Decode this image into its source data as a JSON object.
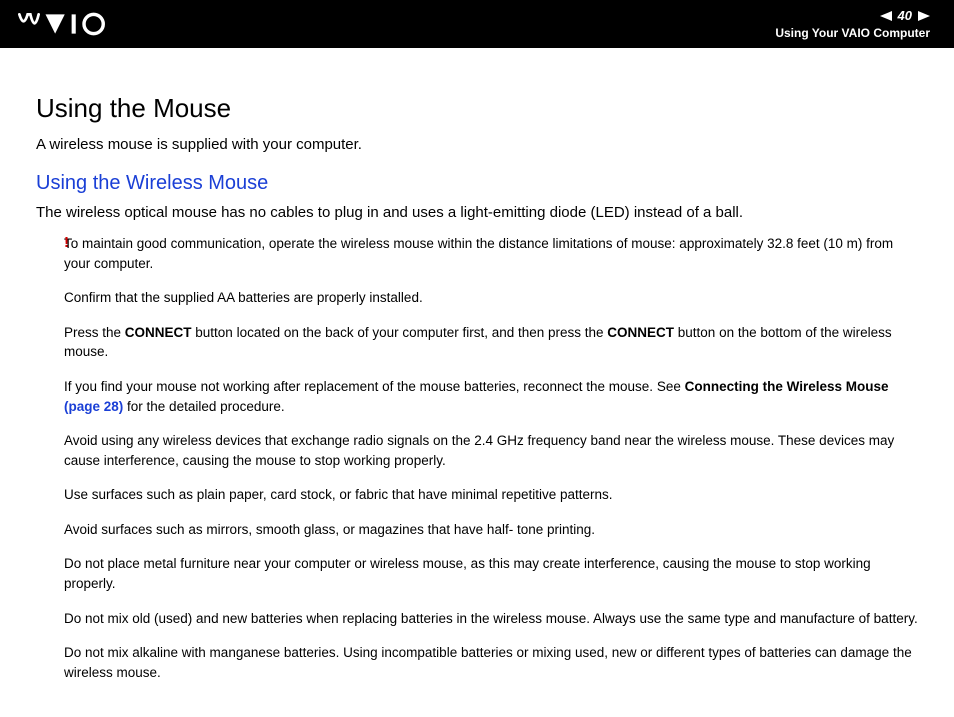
{
  "header": {
    "page_number": "40",
    "section": "Using Your VAIO Computer"
  },
  "content": {
    "heading": "Using the Mouse",
    "intro": "A wireless mouse is supplied with your computer.",
    "sub_heading": "Using the Wireless Mouse",
    "desc": "The wireless optical mouse has no cables to plug in and uses a light-emitting diode (LED) instead of a ball.",
    "exclaim": "!",
    "notes": {
      "n1": "To maintain good communication, operate the wireless mouse within the distance limitations of mouse: approximately 32.8 feet (10 m) from your computer.",
      "n2": "Confirm that the supplied AA batteries are properly installed.",
      "n3a": "Press the ",
      "n3b": "CONNECT",
      "n3c": " button located on the back of your computer first, and then press the ",
      "n3d": "CONNECT",
      "n3e": " button on the bottom of the wireless mouse.",
      "n4a": "If you find your mouse not working after replacement of the mouse batteries, reconnect the mouse. See ",
      "n4b": "Connecting the Wireless Mouse ",
      "n4c": "(page 28)",
      "n4d": " for the detailed procedure.",
      "n5": "Avoid using any wireless devices that exchange radio signals on the 2.4 GHz frequency band near the wireless mouse. These devices may cause interference, causing the mouse to stop working properly.",
      "n6": "Use surfaces such as plain paper, card stock, or fabric that have minimal repetitive patterns.",
      "n7": "Avoid surfaces such as mirrors, smooth glass, or magazines that have half- tone printing.",
      "n8": "Do not place metal furniture near your computer or wireless mouse, as this may create interference, causing the mouse to stop working properly.",
      "n9": "Do not mix old (used) and new batteries when replacing batteries in the wireless mouse. Always use the same type and manufacture of battery.",
      "n10": "Do not mix alkaline with manganese batteries. Using incompatible batteries or mixing used, new or different types of batteries can damage the wireless mouse."
    }
  }
}
